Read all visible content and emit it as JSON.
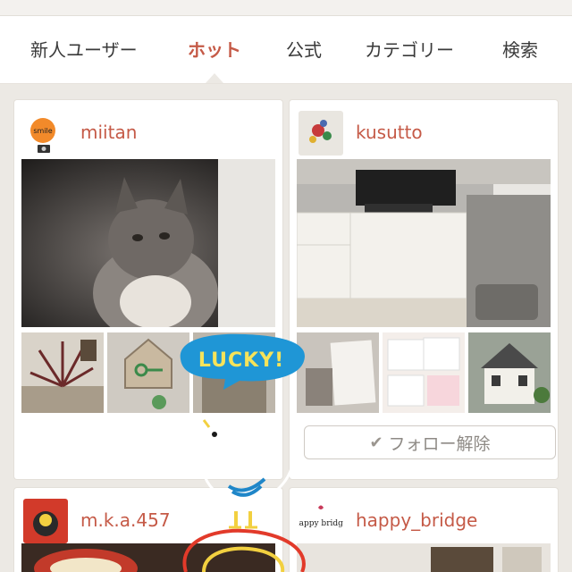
{
  "tabs": [
    {
      "label": "新人ユーザー"
    },
    {
      "label": "ホット"
    },
    {
      "label": "公式"
    },
    {
      "label": "カテゴリー"
    },
    {
      "label": "検索"
    }
  ],
  "active_tab": "ホット",
  "cards": [
    {
      "username": "miitan",
      "avatar_text": "smile"
    },
    {
      "username": "kusutto",
      "follow_label": "フォロー解除"
    },
    {
      "username": "m.k.a.457"
    },
    {
      "username": "happy_bridge",
      "avatar_text": "happy bridge"
    }
  ],
  "sticker": {
    "text": "LUCKY!"
  },
  "colors": {
    "accent": "#c55a47",
    "background": "#ece9e4"
  }
}
